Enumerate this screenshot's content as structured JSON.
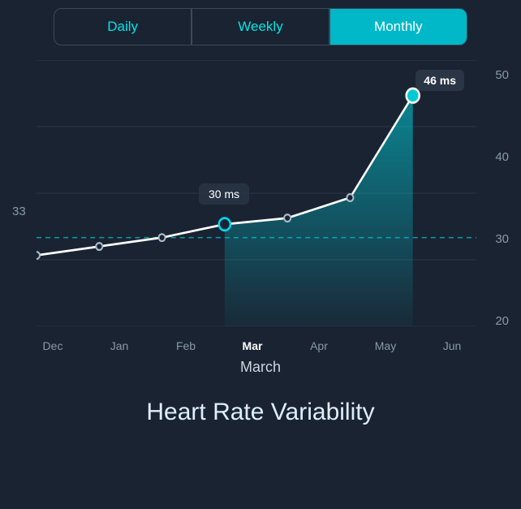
{
  "header": {
    "title": "Heart Rate Variability"
  },
  "tabs": [
    {
      "label": "Daily",
      "active": false
    },
    {
      "label": "Weekly",
      "active": false
    },
    {
      "label": "Monthly",
      "active": true
    }
  ],
  "chart": {
    "y_labels": [
      "50",
      "40",
      "30",
      "20"
    ],
    "x_labels": [
      {
        "label": "Dec",
        "active": false
      },
      {
        "label": "Jan",
        "active": false
      },
      {
        "label": "Feb",
        "active": false
      },
      {
        "label": "Mar",
        "active": true
      },
      {
        "label": "Apr",
        "active": false
      },
      {
        "label": "May",
        "active": false
      },
      {
        "label": "Jun",
        "active": false
      }
    ],
    "y_left_value": "33",
    "tooltip_top": "46 ms",
    "tooltip_mid": "30 ms",
    "month_label": "March",
    "dashed_line_y": "30"
  }
}
